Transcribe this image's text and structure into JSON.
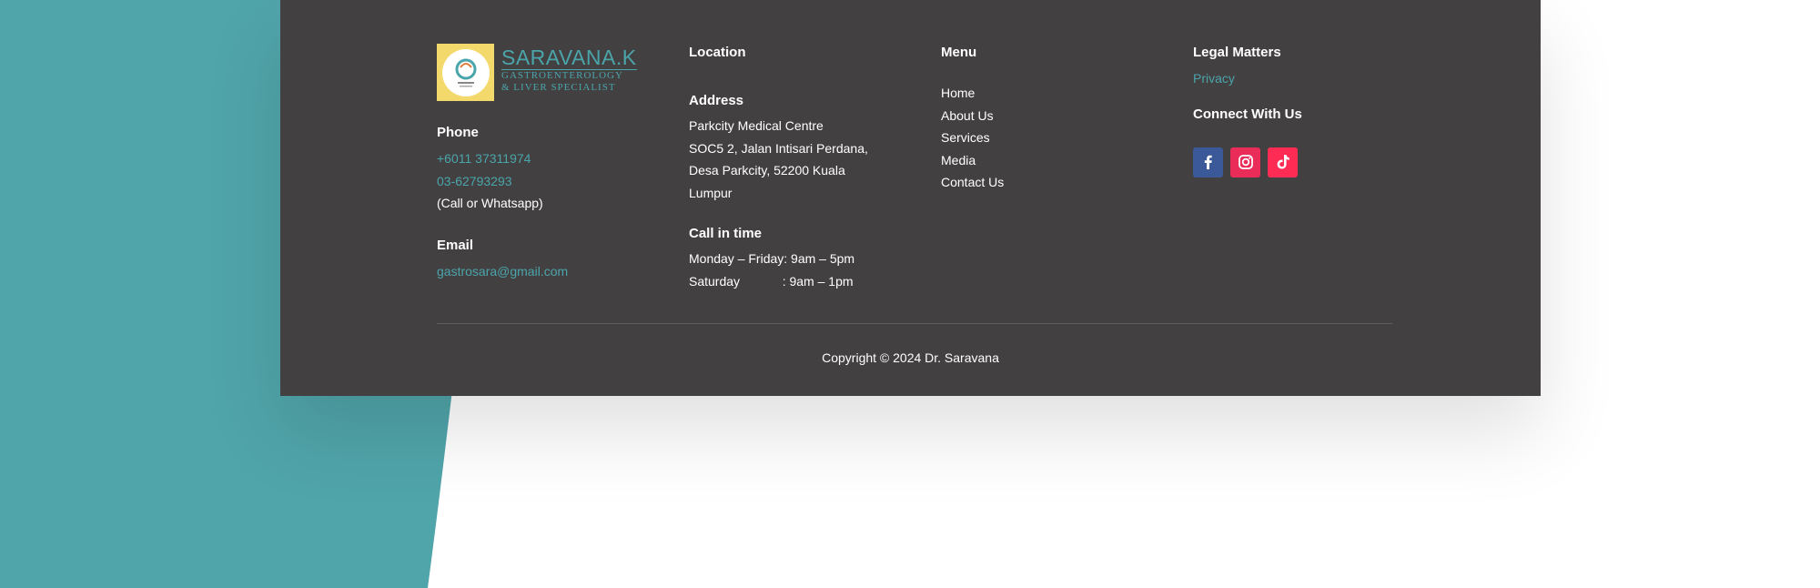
{
  "colors": {
    "teal_background": "#50a5aa",
    "footer_bg": "#434041",
    "link": "#4aa5ab",
    "facebook": "#3b5998",
    "instagram": "#ea2c59",
    "tiktok": "#fe2c55"
  },
  "brand": {
    "name": "SARAVANA.K",
    "line1": "GASTROENTEROLOGY",
    "line2": "& LIVER SPECIALIST"
  },
  "phone": {
    "heading": "Phone",
    "number1": "+6011 37311974",
    "number2": "03-62793293",
    "note": "(Call or Whatsapp)"
  },
  "email": {
    "heading": "Email",
    "address": "gastrosara@gmail.com"
  },
  "location": {
    "heading": "Location",
    "address_heading": "Address",
    "address_lines": [
      "Parkcity Medical Centre",
      "SOC5 2, Jalan Intisari Perdana,",
      "Desa Parkcity, 52200 Kuala",
      "Lumpur"
    ],
    "hours_heading": "Call in time",
    "hours_lines": [
      "Monday – Friday: 9am – 5pm",
      "Saturday            : 9am – 1pm"
    ]
  },
  "menu": {
    "heading": "Menu",
    "items": [
      "Home",
      "About Us",
      "Services",
      "Media",
      "Contact Us"
    ]
  },
  "legal": {
    "heading": "Legal Matters",
    "privacy": "Privacy",
    "connect_heading": "Connect With Us",
    "socials": [
      {
        "icon": "facebook-icon"
      },
      {
        "icon": "instagram-icon"
      },
      {
        "icon": "tiktok-icon"
      }
    ]
  },
  "copyright": "Copyright © 2024 Dr. Saravana"
}
